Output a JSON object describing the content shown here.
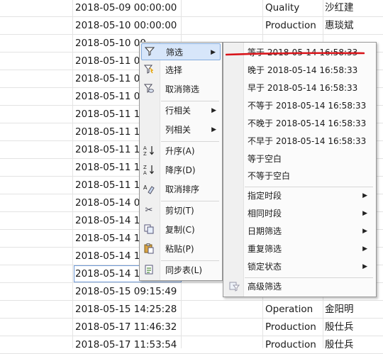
{
  "rows": [
    {
      "date": "2018-05-09 00:00:00",
      "dept": "Quality",
      "name": "沙红建"
    },
    {
      "date": "2018-05-10 00:00:00",
      "dept": "Production",
      "name": "惠琰斌"
    },
    {
      "date": "2018-05-10 00",
      "dept": "",
      "name": ""
    },
    {
      "date": "2018-05-11 0",
      "dept": "",
      "name": ""
    },
    {
      "date": "2018-05-11 0",
      "dept": "",
      "name": ""
    },
    {
      "date": "2018-05-11 0",
      "dept": "",
      "name": ""
    },
    {
      "date": "2018-05-11 1",
      "dept": "",
      "name": ""
    },
    {
      "date": "2018-05-11 1",
      "dept": "",
      "name": ""
    },
    {
      "date": "2018-05-11 1",
      "dept": "",
      "name": ""
    },
    {
      "date": "2018-05-11 1",
      "dept": "",
      "name": ""
    },
    {
      "date": "2018-05-11 1",
      "dept": "",
      "name": ""
    },
    {
      "date": "2018-05-14 0",
      "dept": "",
      "name": ""
    },
    {
      "date": "2018-05-14 1",
      "dept": "",
      "name": ""
    },
    {
      "date": "2018-05-14 1",
      "dept": "",
      "name": ""
    },
    {
      "date": "2018-05-14 1",
      "dept": "",
      "name": ""
    },
    {
      "date": "2018-05-14 1",
      "dept": "",
      "name": ""
    },
    {
      "date": "2018-05-15 09:15:49",
      "dept": "",
      "name": ""
    },
    {
      "date": "2018-05-15 14:25:28",
      "dept": "Operation",
      "name": "金阳明"
    },
    {
      "date": "2018-05-17 11:46:32",
      "dept": "Production",
      "name": "殷仕兵"
    },
    {
      "date": "2018-05-17 11:53:54",
      "dept": "Production",
      "name": "殷仕兵"
    }
  ],
  "menu": {
    "items": [
      {
        "label": "筛选",
        "icon": "filter-icon",
        "arrow": "▶",
        "highlight": true
      },
      {
        "label": "选择",
        "icon": "select-icon"
      },
      {
        "label": "取消筛选",
        "icon": "clear-filter-icon"
      },
      {
        "label": "行相关",
        "arrow": "▶"
      },
      {
        "label": "列相关",
        "arrow": "▶"
      },
      {
        "label": "升序(A)",
        "icon": "sort-ascending-icon"
      },
      {
        "label": "降序(D)",
        "icon": "sort-descending-icon"
      },
      {
        "label": "取消排序",
        "icon": "clear-sort-icon"
      },
      {
        "label": "剪切(T)",
        "icon": "scissors-icon"
      },
      {
        "label": "复制(C)",
        "icon": "copy-icon"
      },
      {
        "label": "粘贴(P)",
        "icon": "paste-icon"
      },
      {
        "label": "同步表(L)",
        "icon": "sync-table-icon"
      }
    ]
  },
  "submenu": {
    "items": [
      {
        "label": "等于 2018-05-14 16:58:33"
      },
      {
        "label": "晚于 2018-05-14 16:58:33"
      },
      {
        "label": "早于 2018-05-14 16:58:33"
      },
      {
        "label": "不等于 2018-05-14 16:58:33"
      },
      {
        "label": "不晚于 2018-05-14 16:58:33"
      },
      {
        "label": "不早于 2018-05-14 16:58:33"
      },
      {
        "label": "等于空白"
      },
      {
        "label": "不等于空白"
      },
      {
        "label": "指定时段",
        "arrow": "▶"
      },
      {
        "label": "相同时段",
        "arrow": "▶"
      },
      {
        "label": "日期筛选",
        "arrow": "▶"
      },
      {
        "label": "重复筛选",
        "arrow": "▶"
      },
      {
        "label": "锁定状态",
        "arrow": "▶"
      },
      {
        "label": "高级筛选",
        "icon": "advanced-filter-icon"
      }
    ]
  },
  "annotation_color": "#d8141a"
}
